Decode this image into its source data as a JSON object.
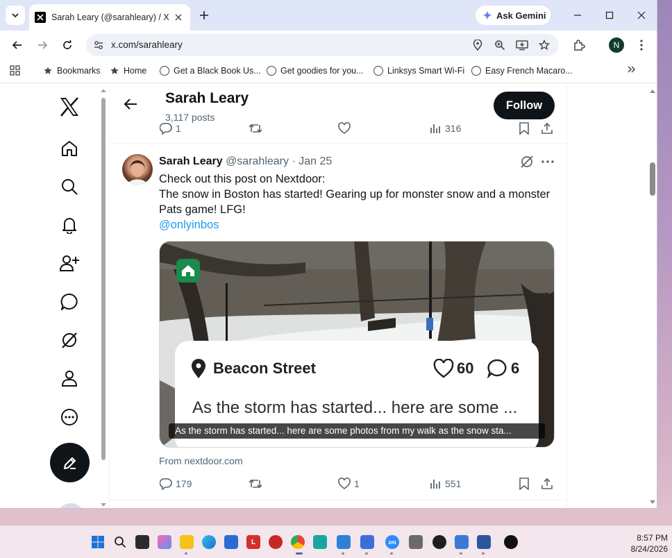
{
  "browser": {
    "tab_title": "Sarah Leary (@sarahleary) / X",
    "url": "x.com/sarahleary",
    "gemini_label": "Ask Gemini",
    "profile_initial": "N",
    "bookmarks": [
      "Bookmarks",
      "Home",
      "Get a Black Book Us...",
      "Get goodies for you...",
      "Linksys Smart Wi-Fi",
      "Easy French Macaro..."
    ]
  },
  "header": {
    "name": "Sarah Leary",
    "posts_count": "3,117 posts",
    "follow_label": "Follow"
  },
  "prev_tweet": {
    "replies": "1",
    "views": "316"
  },
  "tweet": {
    "display_name": "Sarah Leary",
    "meta": "@sarahleary · Jan 25",
    "line1": "Check out this post on Nextdoor:",
    "line2": "The snow in Boston has started! Gearing up for monster snow and a monster Pats game! LFG!",
    "mention": "@onlyinbos",
    "card": {
      "street": "Beacon Street",
      "likes": "60",
      "comments": "6",
      "preview": "As the storm has started... here are some ...",
      "caption": "As the storm has started... here are some photos from my walk as the snow sta..."
    },
    "from": "From nextdoor.com",
    "replies": "179",
    "likes": "1",
    "views": "551"
  },
  "taskbar": {
    "time": "8:57 PM",
    "date": "8/24/2026"
  },
  "colors": {
    "x_black": "#0f1419",
    "link_blue": "#1d9bf0",
    "muted_text": "#536471",
    "nextdoor_green": "#1b8a4a"
  }
}
